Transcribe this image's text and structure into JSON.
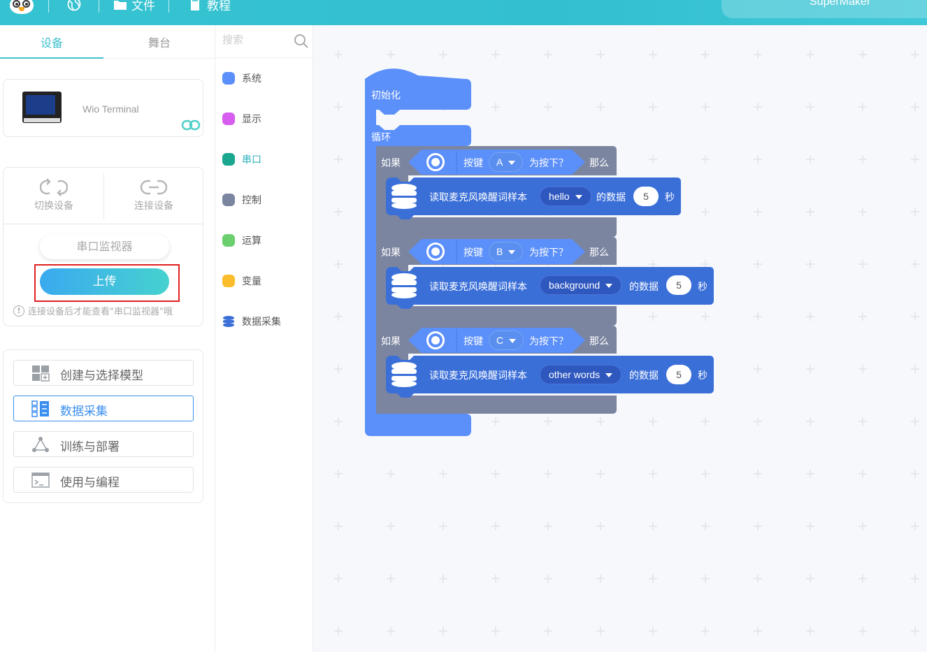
{
  "topbar": {
    "menu_file": "文件",
    "menu_tutorial": "教程",
    "brand": "SuperMaker"
  },
  "left": {
    "tabs": [
      "设备",
      "舞台"
    ],
    "device_name": "Wio Terminal",
    "switch_device": "切换设备",
    "connect_device": "连接设备",
    "serial_monitor": "串口监视器",
    "upload": "上传",
    "warning": "连接设备后才能查看\"串口监视器\"哦",
    "menu": [
      "创建与选择模型",
      "数据采集",
      "训练与部署",
      "使用与编程"
    ]
  },
  "categories": {
    "search_placeholder": "搜索",
    "items": [
      {
        "label": "系统",
        "color": "#5b8ff9"
      },
      {
        "label": "显示",
        "color": "#d65df0"
      },
      {
        "label": "串口",
        "color": "#1aa68f"
      },
      {
        "label": "控制",
        "color": "#7b85a0"
      },
      {
        "label": "运算",
        "color": "#6ccf6e"
      },
      {
        "label": "变量",
        "color": "#fbbd2c"
      },
      {
        "label": "数据采集",
        "color": "#3b6fd8"
      }
    ],
    "active_index": 2
  },
  "blocks": {
    "init": "初始化",
    "loop": "循环",
    "if": "如果",
    "key": "按键",
    "pressed": "为按下？",
    "then": "那么",
    "read": "读取麦克风唤醒词样本",
    "data_of": "的数据",
    "seconds": "秒",
    "rows": [
      {
        "button": "A",
        "sample": "hello",
        "duration": "5"
      },
      {
        "button": "B",
        "sample": "background",
        "duration": "5"
      },
      {
        "button": "C",
        "sample": "other words",
        "duration": "5"
      }
    ]
  },
  "colors": {
    "accent": "#3fc1cf",
    "event_block": "#5b8ff9",
    "control_block": "#7b85a0",
    "data_block": "#3b6fd8",
    "upload_highlight": "#e02020"
  }
}
